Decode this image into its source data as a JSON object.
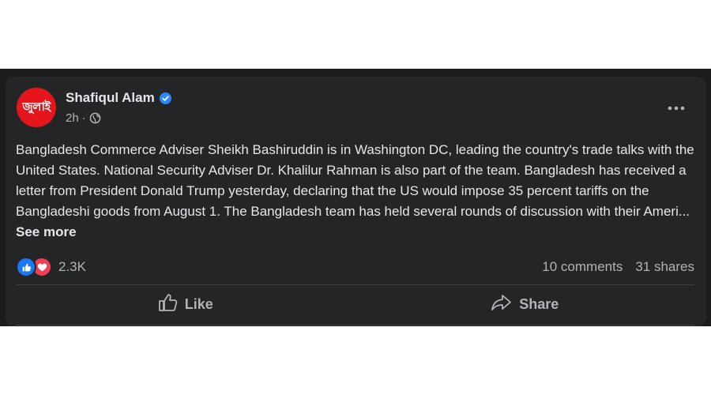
{
  "post": {
    "author": "Shafiqul Alam",
    "avatar_text": "জুলাই",
    "time": "2h",
    "body": "Bangladesh Commerce Adviser Sheikh Bashiruddin is in Washington DC, leading the country's trade talks with the United States. National Security Adviser Dr. Khalilur Rahman is also part of the team. Bangladesh has received a letter from President Donald Trump yesterday, declaring that the US would impose 35 percent tariffs on the Bangladeshi goods from August 1. The Bangladesh team has held several rounds of discussion with their Ameri... ",
    "see_more": "See more",
    "reaction_count": "2.3K",
    "comments": "10 comments",
    "shares": "31 shares",
    "actions": {
      "like": "Like",
      "share": "Share"
    }
  },
  "icons": {
    "verified": "verified-badge-icon",
    "audience": "globe-icon",
    "more": "more-options-icon",
    "like": "thumbs-up-icon",
    "share": "share-arrow-icon"
  },
  "colors": {
    "background": "#242526",
    "text": "#e4e6eb",
    "secondary": "#b0b3b8",
    "like_blue": "#1877f2",
    "love_red": "#f33e58",
    "verified_blue": "#2d88ff",
    "avatar_red": "#e4161b"
  }
}
